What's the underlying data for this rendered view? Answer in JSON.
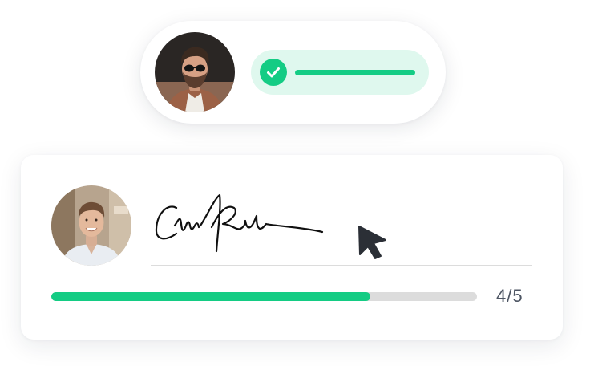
{
  "colors": {
    "accent": "#14cc84",
    "accent_light": "#dff8ee",
    "track": "#dcdcdc",
    "text": "#4d5563",
    "cursor": "#2b2f36"
  },
  "top_card": {
    "avatar": "person-with-sunglasses",
    "status_icon": "check-icon"
  },
  "sign_card": {
    "avatar": "smiling-person",
    "signature": "handwritten-signature",
    "cursor_icon": "pointer-cursor-icon",
    "progress": {
      "current": 4,
      "total": 5,
      "label": "4/5",
      "fill_fraction": 0.75
    }
  }
}
